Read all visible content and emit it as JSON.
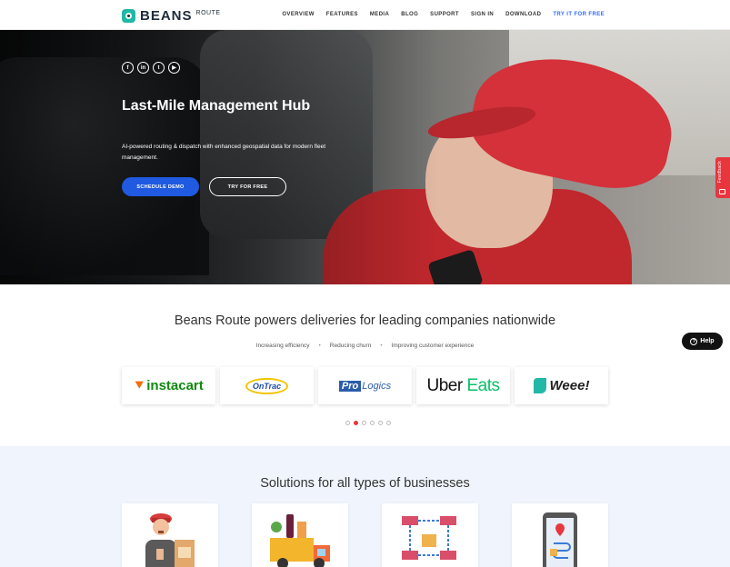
{
  "nav": {
    "brand": "BEANS",
    "brand_sub": "ROUTE",
    "items": [
      "OVERVIEW",
      "FEATURES",
      "MEDIA",
      "BLOG",
      "SUPPORT",
      "SIGN IN",
      "DOWNLOAD"
    ],
    "cta": "TRY IT FOR FREE"
  },
  "hero": {
    "social": [
      "f",
      "in",
      "t",
      "▶"
    ],
    "title": "Last-Mile Management Hub",
    "subtitle": "AI-powered routing & dispatch with enhanced geospatial data for modern fleet management.",
    "primary_button": "SCHEDULE DEMO",
    "secondary_button": "TRY FOR FREE"
  },
  "feedback": {
    "label": "Feedback"
  },
  "partners": {
    "title": "Beans Route powers deliveries for leading companies nationwide",
    "benefits": [
      "Increasing efficiency",
      "Reducing churn",
      "Improving customer experience"
    ],
    "logos": {
      "instacart": "instacart",
      "ontrac": "OnTrac",
      "prologics_pro": "Pro",
      "prologics_rest": "Logics",
      "uber": "Uber",
      "eats": "Eats",
      "weee": "Weee!"
    },
    "carousel_active_index": 1,
    "carousel_count": 6
  },
  "help": {
    "label": "Help"
  },
  "solutions": {
    "title": "Solutions for all types of businesses"
  },
  "colors": {
    "primary": "#1f5ae0",
    "accent": "#e8363f",
    "brand_teal": "#1fb8a6",
    "section_bg": "#f0f5fd"
  }
}
